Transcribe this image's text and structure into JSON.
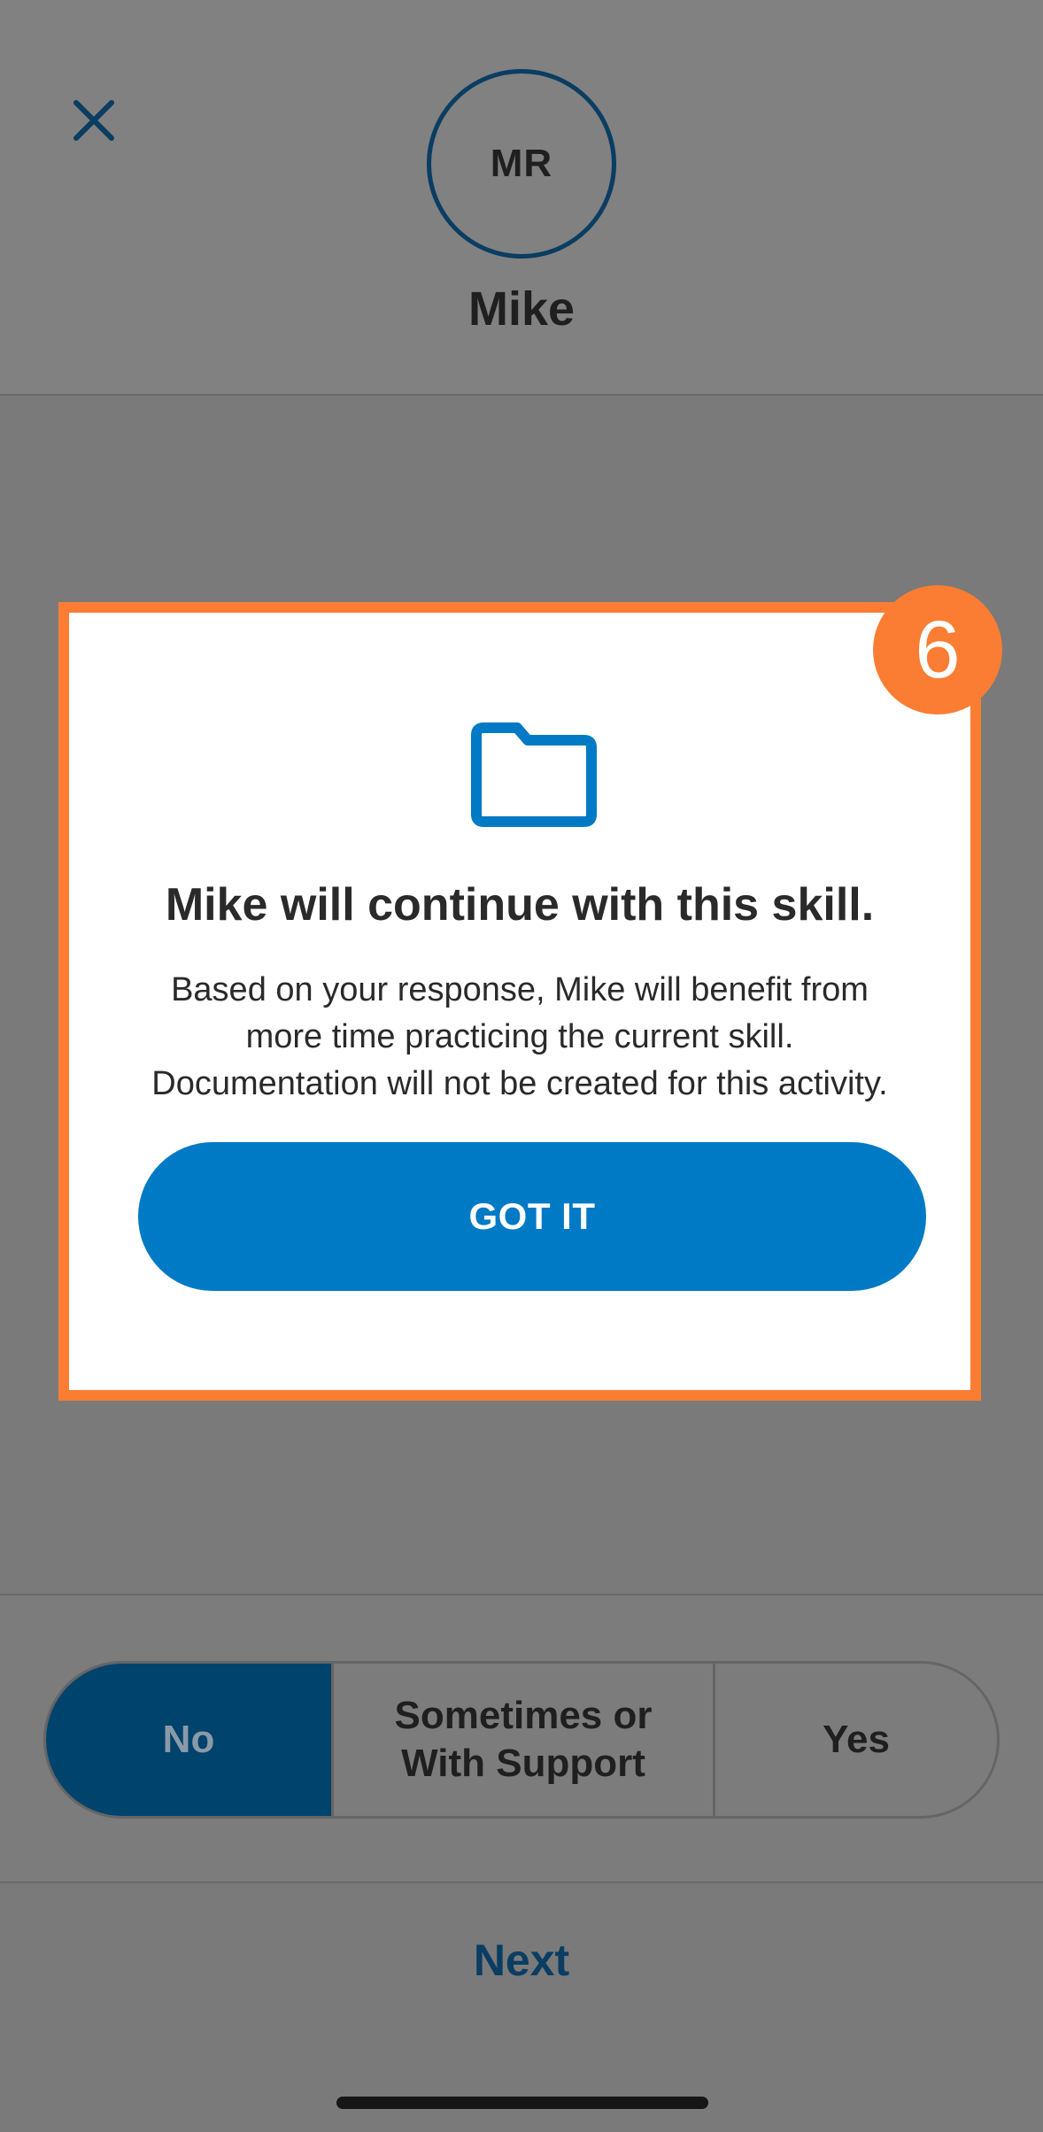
{
  "header": {
    "avatar_initials": "MR",
    "user_name": "Mike"
  },
  "modal": {
    "title": "Mike will continue with this skill.",
    "body": "Based on your response, Mike will benefit from more time practicing the current skill. Documentation will not be created for this activity.",
    "button_label": "GOT IT",
    "step_number": "6"
  },
  "answers": {
    "options": [
      "No",
      "Sometimes or With Support",
      "Yes"
    ],
    "selected": "No"
  },
  "footer": {
    "next_label": "Next"
  },
  "colors": {
    "accent": "#007ac4",
    "dark_accent": "#0a3d62",
    "highlight": "#fb7d33"
  }
}
